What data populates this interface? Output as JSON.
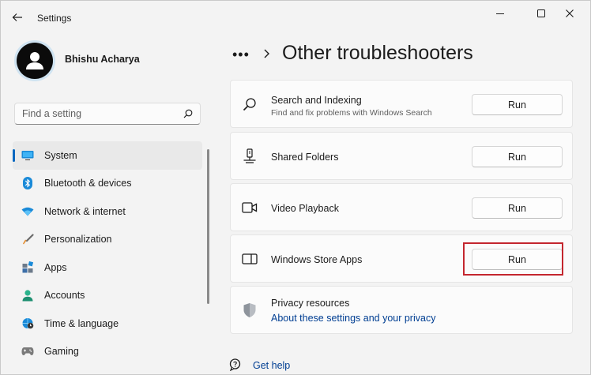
{
  "window": {
    "title": "Settings"
  },
  "profile": {
    "name": "Bhishu Acharya"
  },
  "search": {
    "placeholder": "Find a setting"
  },
  "sidebar": {
    "items": [
      {
        "label": "System",
        "icon": "monitor-icon",
        "active": true
      },
      {
        "label": "Bluetooth & devices",
        "icon": "bluetooth-icon"
      },
      {
        "label": "Network & internet",
        "icon": "wifi-icon"
      },
      {
        "label": "Personalization",
        "icon": "brush-icon"
      },
      {
        "label": "Apps",
        "icon": "apps-icon"
      },
      {
        "label": "Accounts",
        "icon": "person-icon"
      },
      {
        "label": "Time & language",
        "icon": "globe-clock-icon"
      },
      {
        "label": "Gaming",
        "icon": "gamepad-icon"
      }
    ]
  },
  "breadcrumb": {
    "dots": "•••",
    "title": "Other troubleshooters"
  },
  "troubleshooters": [
    {
      "title": "Search and Indexing",
      "description": "Find and fix problems with Windows Search",
      "button": "Run",
      "icon": "search-icon"
    },
    {
      "title": "Shared Folders",
      "button": "Run",
      "icon": "shared-folder-icon"
    },
    {
      "title": "Video Playback",
      "button": "Run",
      "icon": "video-camera-icon"
    },
    {
      "title": "Windows Store Apps",
      "button": "Run",
      "icon": "store-app-icon"
    }
  ],
  "privacy": {
    "title": "Privacy resources",
    "link": "About these settings and your privacy",
    "icon": "shield-icon"
  },
  "help": {
    "label": "Get help",
    "icon": "help-chat-icon"
  },
  "colors": {
    "accent": "#0067c0",
    "highlight": "#c4262e",
    "link": "#003e92"
  }
}
